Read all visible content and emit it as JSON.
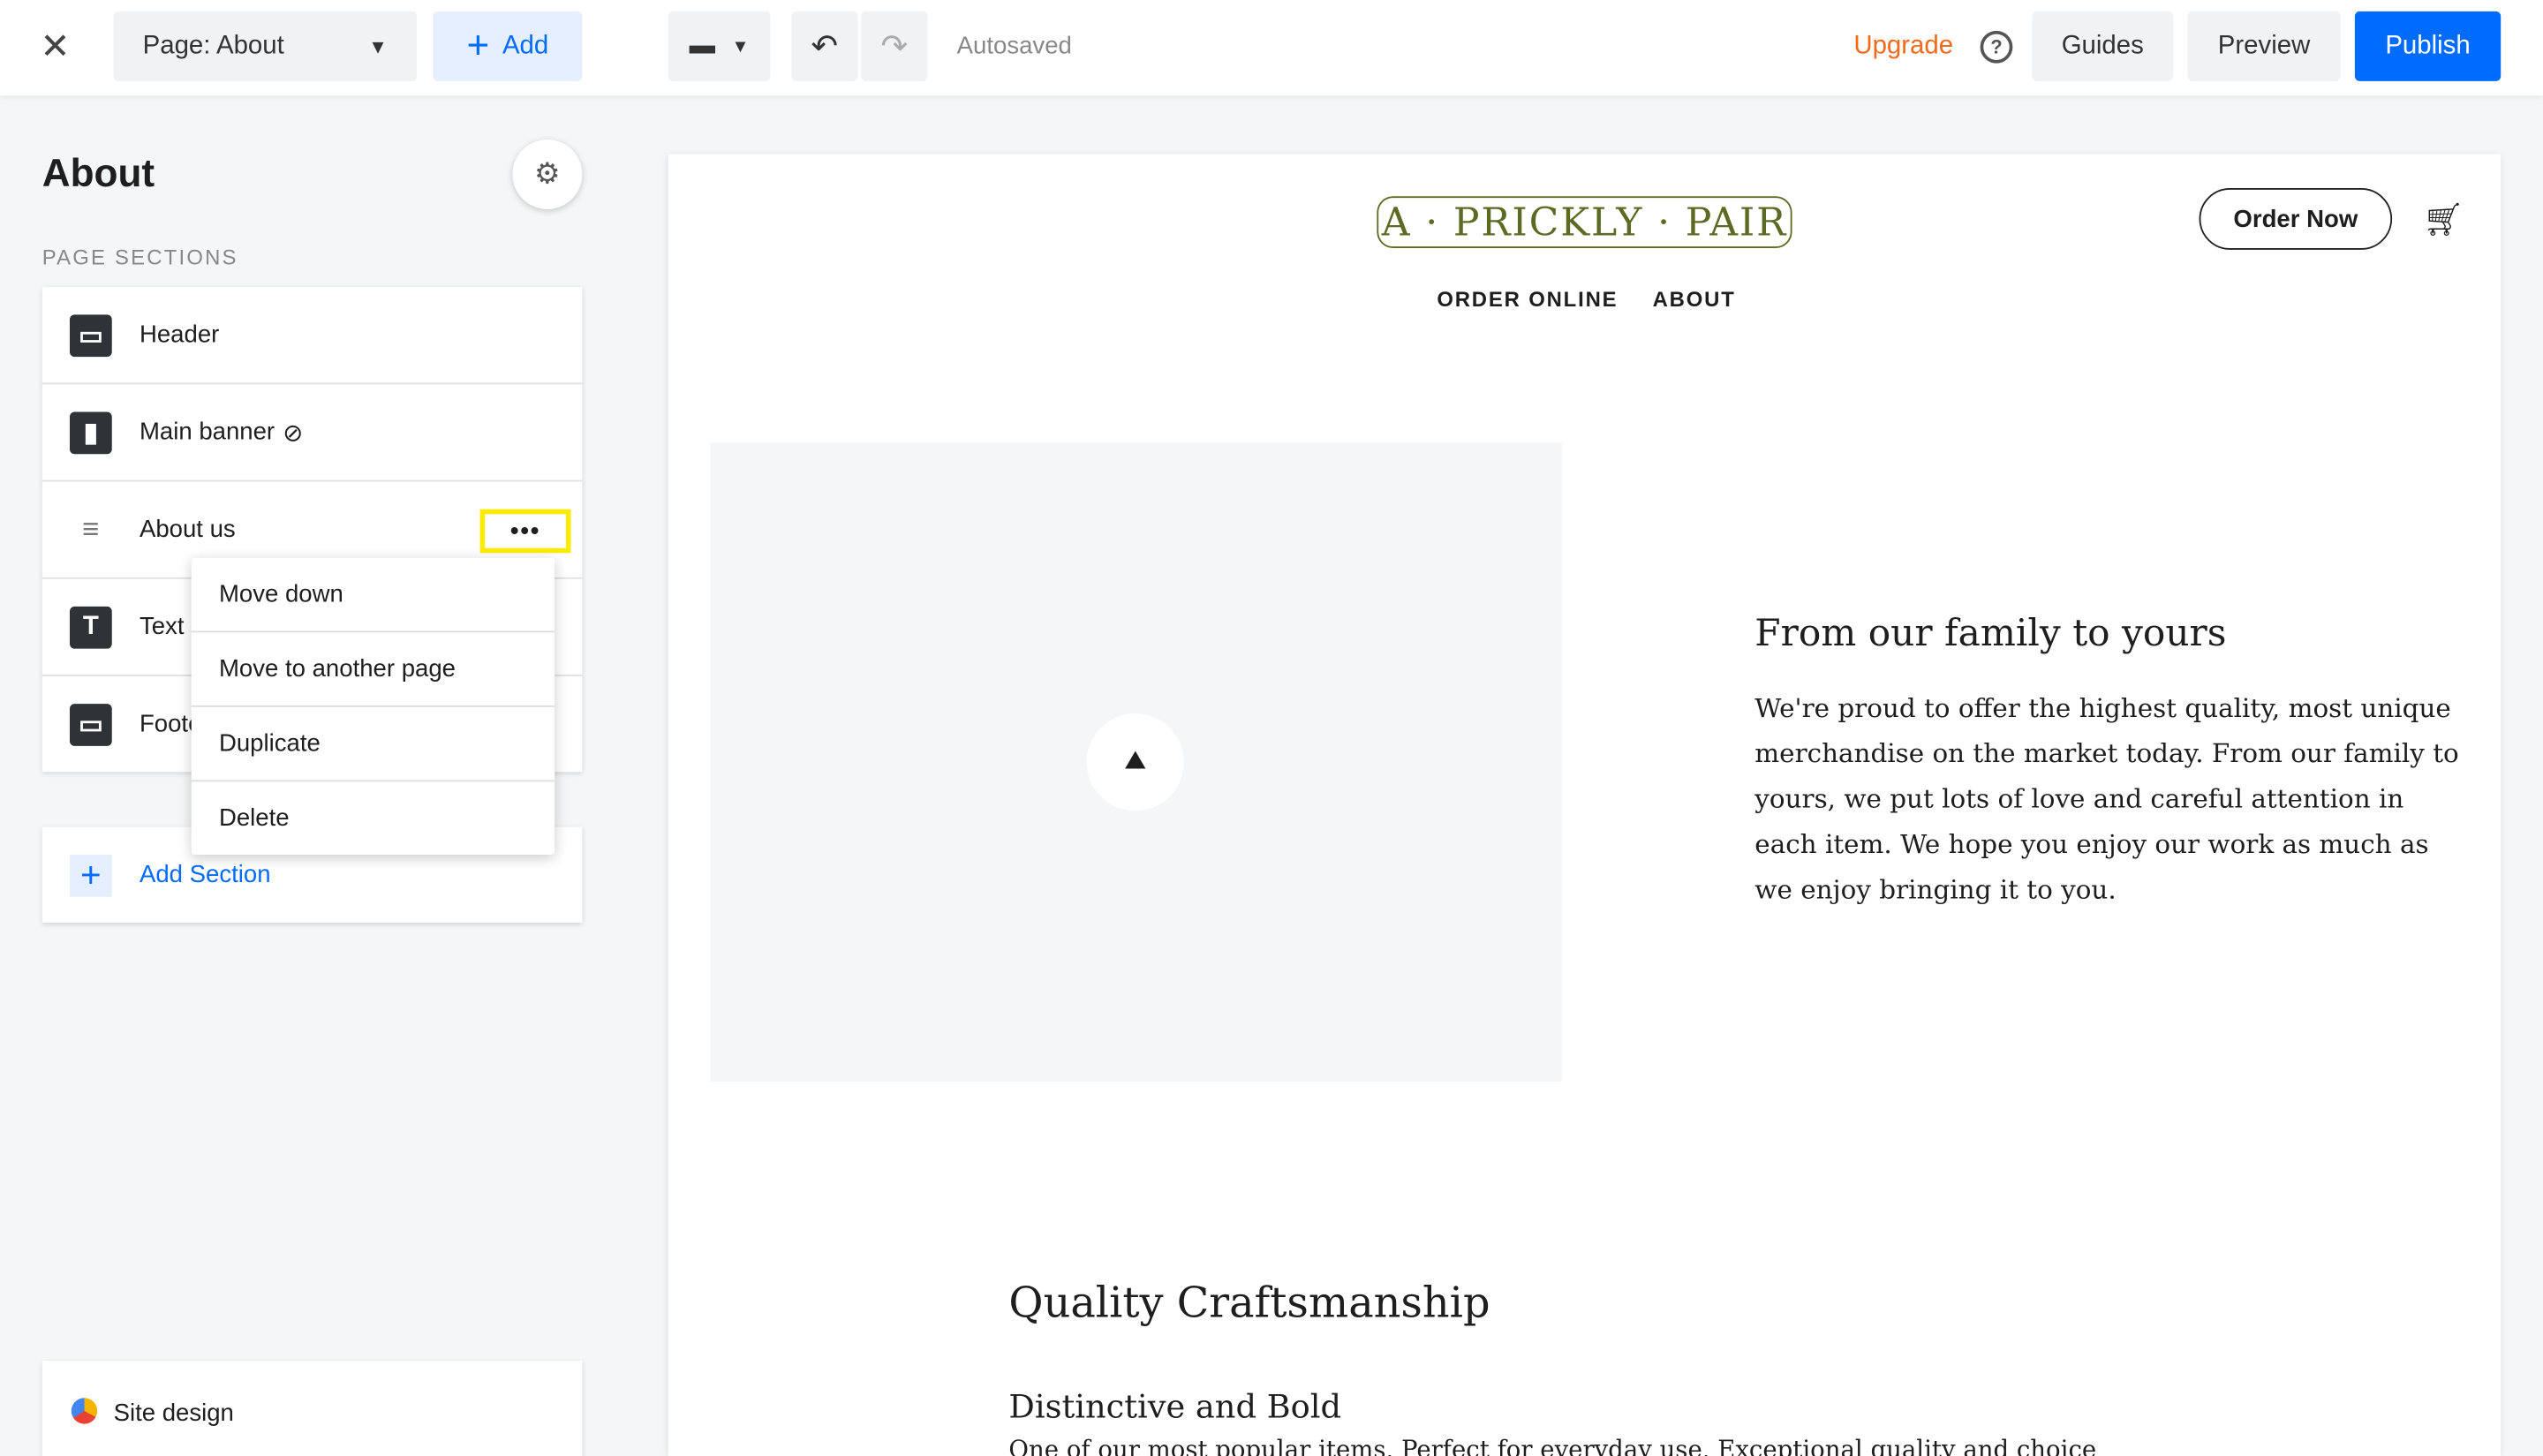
{
  "topbar": {
    "page_select": "Page: About",
    "add": "Add",
    "autosaved": "Autosaved",
    "upgrade": "Upgrade",
    "guides": "Guides",
    "preview": "Preview",
    "publish": "Publish"
  },
  "sidebar": {
    "title": "About",
    "section_label": "PAGE SECTIONS",
    "items": [
      {
        "label": "Header",
        "icon": "header-icon"
      },
      {
        "label": "Main banner",
        "icon": "bookmark-icon"
      },
      {
        "label": "About us",
        "icon": "drag-handle-icon"
      },
      {
        "label": "Text",
        "icon": "text-icon"
      },
      {
        "label": "Footer",
        "icon": "footer-icon"
      }
    ],
    "add_section": "Add Section",
    "site_design": "Site design"
  },
  "context_menu": [
    "Move down",
    "Move to another page",
    "Duplicate",
    "Delete"
  ],
  "site": {
    "logo": "A · PRICKLY · PAIR",
    "order_now": "Order Now",
    "nav": [
      "ORDER ONLINE",
      "ABOUT"
    ],
    "about_heading": "From our family to yours",
    "about_body": "We're proud to offer the highest quality, most unique merchandise on the market today. From our family to yours, we put lots of love and careful attention in each item. We hope you enjoy our work as much as we enjoy bringing it to you.",
    "section2_heading": "Quality Craftsmanship",
    "item_heading": "Distinctive and Bold",
    "item_body": "One of our most popular items. Perfect for everyday use. Exceptional quality and choice"
  },
  "colors": {
    "accent": "#006bff",
    "upgrade": "#f26a1b",
    "highlight": "#ffeb00",
    "logo": "#5c6a23"
  }
}
